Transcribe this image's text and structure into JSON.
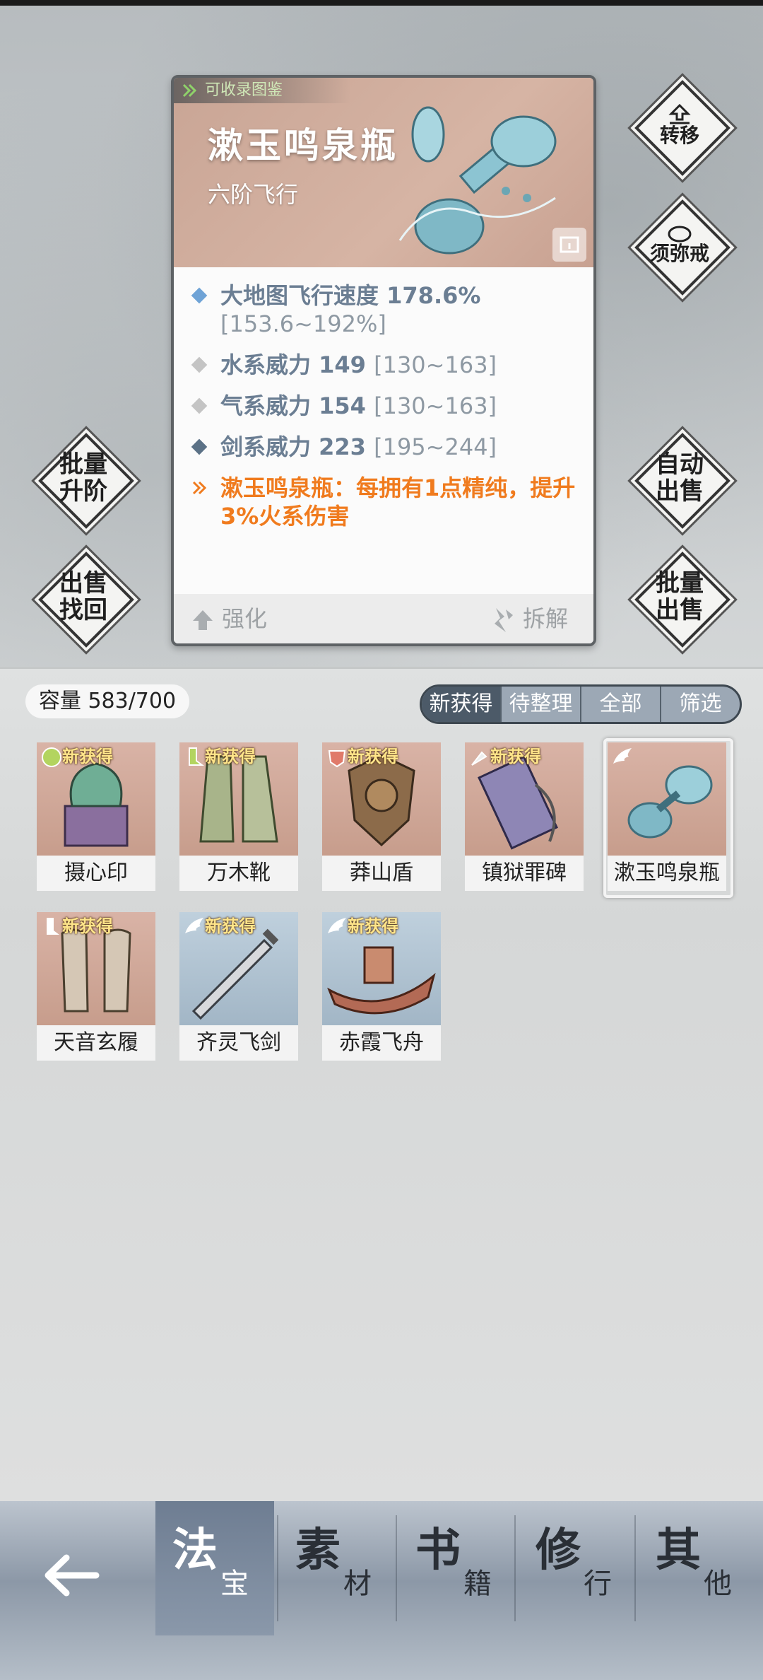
{
  "card": {
    "collect_tag": "可收录图鉴",
    "name": "漱玉鸣泉瓶",
    "subtitle": "六阶飞行",
    "stats": [
      {
        "text": "大地图飞行速度 178.6%",
        "range": "[153.6~192%]",
        "color": "#6fa3d6"
      },
      {
        "text": "水系威力 149",
        "range": "[130~163]",
        "color": "#c4c4c4"
      },
      {
        "text": "气系威力 154",
        "range": "[130~163]",
        "color": "#c4c4c4"
      },
      {
        "text": "剑系威力 223",
        "range": "[195~244]",
        "color": "#5b7186"
      }
    ],
    "special": "漱玉鸣泉瓶：每拥有1点精纯，提升3%火系伤害",
    "footer": {
      "enhance": "强化",
      "dismantle": "拆解"
    }
  },
  "side_buttons": {
    "transfer": "转移",
    "ring": "须弥戒",
    "batch_upgrade": [
      "批量",
      "升阶"
    ],
    "auto_sell": [
      "自动",
      "出售"
    ],
    "sell_retrieve": [
      "出售",
      "找回"
    ],
    "batch_sell": [
      "批量",
      "出售"
    ]
  },
  "inventory": {
    "capacity": "容量 583/700",
    "filters": [
      "新获得",
      "待整理",
      "全部",
      "筛选"
    ],
    "new_label": "新获得",
    "items": [
      {
        "name": "摄心印",
        "new": true,
        "bg": "red",
        "icon": "seal-icon"
      },
      {
        "name": "万木靴",
        "new": true,
        "bg": "red",
        "icon": "boots-icon"
      },
      {
        "name": "莽山盾",
        "new": true,
        "bg": "red",
        "icon": "shield-icon"
      },
      {
        "name": "镇狱罪碑",
        "new": true,
        "bg": "red",
        "icon": "stele-icon"
      },
      {
        "name": "漱玉鸣泉瓶",
        "new": false,
        "bg": "red",
        "icon": "vase-icon",
        "selected": true
      },
      {
        "name": "天音玄履",
        "new": true,
        "bg": "red",
        "icon": "slippers-icon"
      },
      {
        "name": "齐灵飞剑",
        "new": true,
        "bg": "blue",
        "icon": "sword-icon"
      },
      {
        "name": "赤霞飞舟",
        "new": true,
        "bg": "blue",
        "icon": "boat-icon"
      }
    ]
  },
  "nav": {
    "tabs": [
      {
        "big": "法",
        "small": "宝"
      },
      {
        "big": "素",
        "small": "材"
      },
      {
        "big": "书",
        "small": "籍"
      },
      {
        "big": "修",
        "small": "行"
      },
      {
        "big": "其",
        "small": "他"
      }
    ]
  }
}
